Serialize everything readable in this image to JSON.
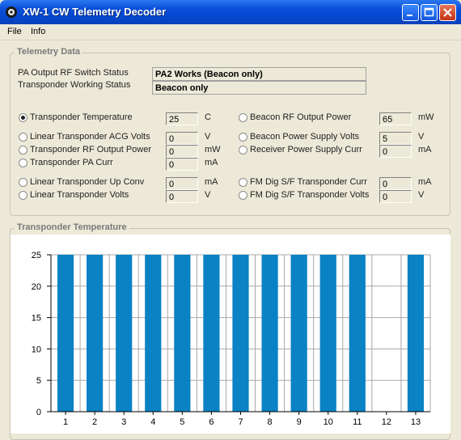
{
  "window": {
    "title": "XW-1 CW Telemetry Decoder"
  },
  "menu": {
    "items": [
      "File",
      "Info"
    ]
  },
  "telemetry": {
    "legend": "Telemetry Data",
    "status": [
      {
        "label": "PA Output RF Switch Status",
        "value": "PA2 Works (Beacon only)"
      },
      {
        "label": "Transponder Working Status",
        "value": "Beacon only"
      }
    ],
    "channels": [
      {
        "label": "Transponder Temperature",
        "value": "25",
        "unit": "C",
        "selected": true
      },
      {
        "label": "Linear Transponder ACG Volts",
        "value": "0",
        "unit": "V",
        "selected": false
      },
      {
        "label": "Transponder RF Output Power",
        "value": "0",
        "unit": "mW",
        "selected": false
      },
      {
        "label": "Transponder PA Curr",
        "value": "0",
        "unit": "mA",
        "selected": false
      },
      {
        "label": "Linear Transponder Up Conv",
        "value": "0",
        "unit": "mA",
        "selected": false
      },
      {
        "label": "Linear Transponder Volts",
        "value": "0",
        "unit": "V",
        "selected": false
      },
      {
        "label": "Beacon RF Output Power",
        "value": "65",
        "unit": "mW",
        "selected": false
      },
      {
        "label": "Beacon Power Supply Volts",
        "value": "5",
        "unit": "V",
        "selected": false
      },
      {
        "label": "Receiver Power Supply Curr",
        "value": "0",
        "unit": "mA",
        "selected": false
      },
      {
        "label": "FM Dig S/F Transponder Curr",
        "value": "0",
        "unit": "mA",
        "selected": false
      },
      {
        "label": "FM Dig S/F Transponder Volts",
        "value": "0",
        "unit": "V",
        "selected": false
      }
    ]
  },
  "chart_panel": {
    "legend": "Transponder Temperature"
  },
  "chart_data": {
    "type": "bar",
    "title": "",
    "xlabel": "",
    "ylabel": "",
    "categories": [
      "1",
      "2",
      "3",
      "4",
      "5",
      "6",
      "7",
      "8",
      "9",
      "10",
      "11",
      "12",
      "13"
    ],
    "values": [
      25,
      25,
      25,
      25,
      25,
      25,
      25,
      25,
      25,
      25,
      25,
      0,
      25
    ],
    "ylim": [
      0,
      25
    ],
    "yticks": [
      0,
      5,
      10,
      15,
      20,
      25
    ],
    "grid": true,
    "bar_color": "#0a82c4",
    "grid_color": "#a8a8a8"
  }
}
